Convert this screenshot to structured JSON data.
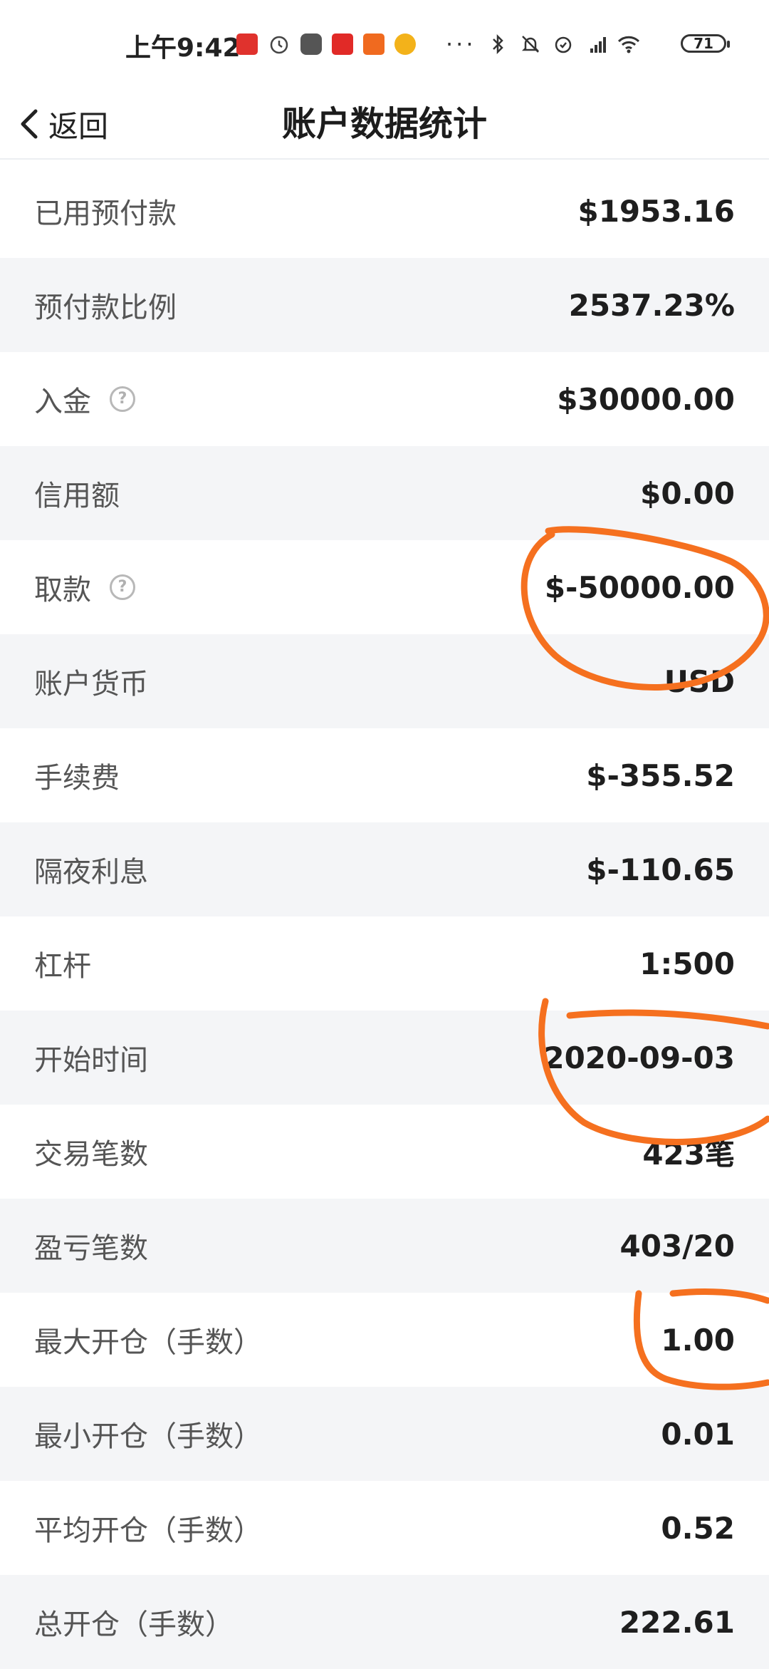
{
  "status_bar": {
    "time": "上午9:42",
    "battery": "71"
  },
  "nav": {
    "back_label": "返回",
    "title": "账户数据统计"
  },
  "rows": [
    {
      "label": "已用预付款",
      "value": "$1953.16",
      "help": false
    },
    {
      "label": "预付款比例",
      "value": "2537.23%",
      "help": false
    },
    {
      "label": "入金",
      "value": "$30000.00",
      "help": true
    },
    {
      "label": "信用额",
      "value": "$0.00",
      "help": false
    },
    {
      "label": "取款",
      "value": "$-50000.00",
      "help": true
    },
    {
      "label": "账户货币",
      "value": "USD",
      "help": false
    },
    {
      "label": "手续费",
      "value": "$-355.52",
      "help": false
    },
    {
      "label": "隔夜利息",
      "value": "$-110.65",
      "help": false
    },
    {
      "label": "杠杆",
      "value": "1:500",
      "help": false
    },
    {
      "label": "开始时间",
      "value": "2020-09-03",
      "help": false
    },
    {
      "label": "交易笔数",
      "value": "423笔",
      "help": false
    },
    {
      "label": "盈亏笔数",
      "value": "403/20",
      "help": false
    },
    {
      "label": "最大开仓（手数）",
      "value": "1.00",
      "help": false
    },
    {
      "label": "最小开仓（手数）",
      "value": "0.01",
      "help": false
    },
    {
      "label": "平均开仓（手数）",
      "value": "0.52",
      "help": false
    },
    {
      "label": "总开仓（手数）",
      "value": "222.61",
      "help": false
    }
  ],
  "help_glyph": "?",
  "annotation_color": "#f5701f"
}
